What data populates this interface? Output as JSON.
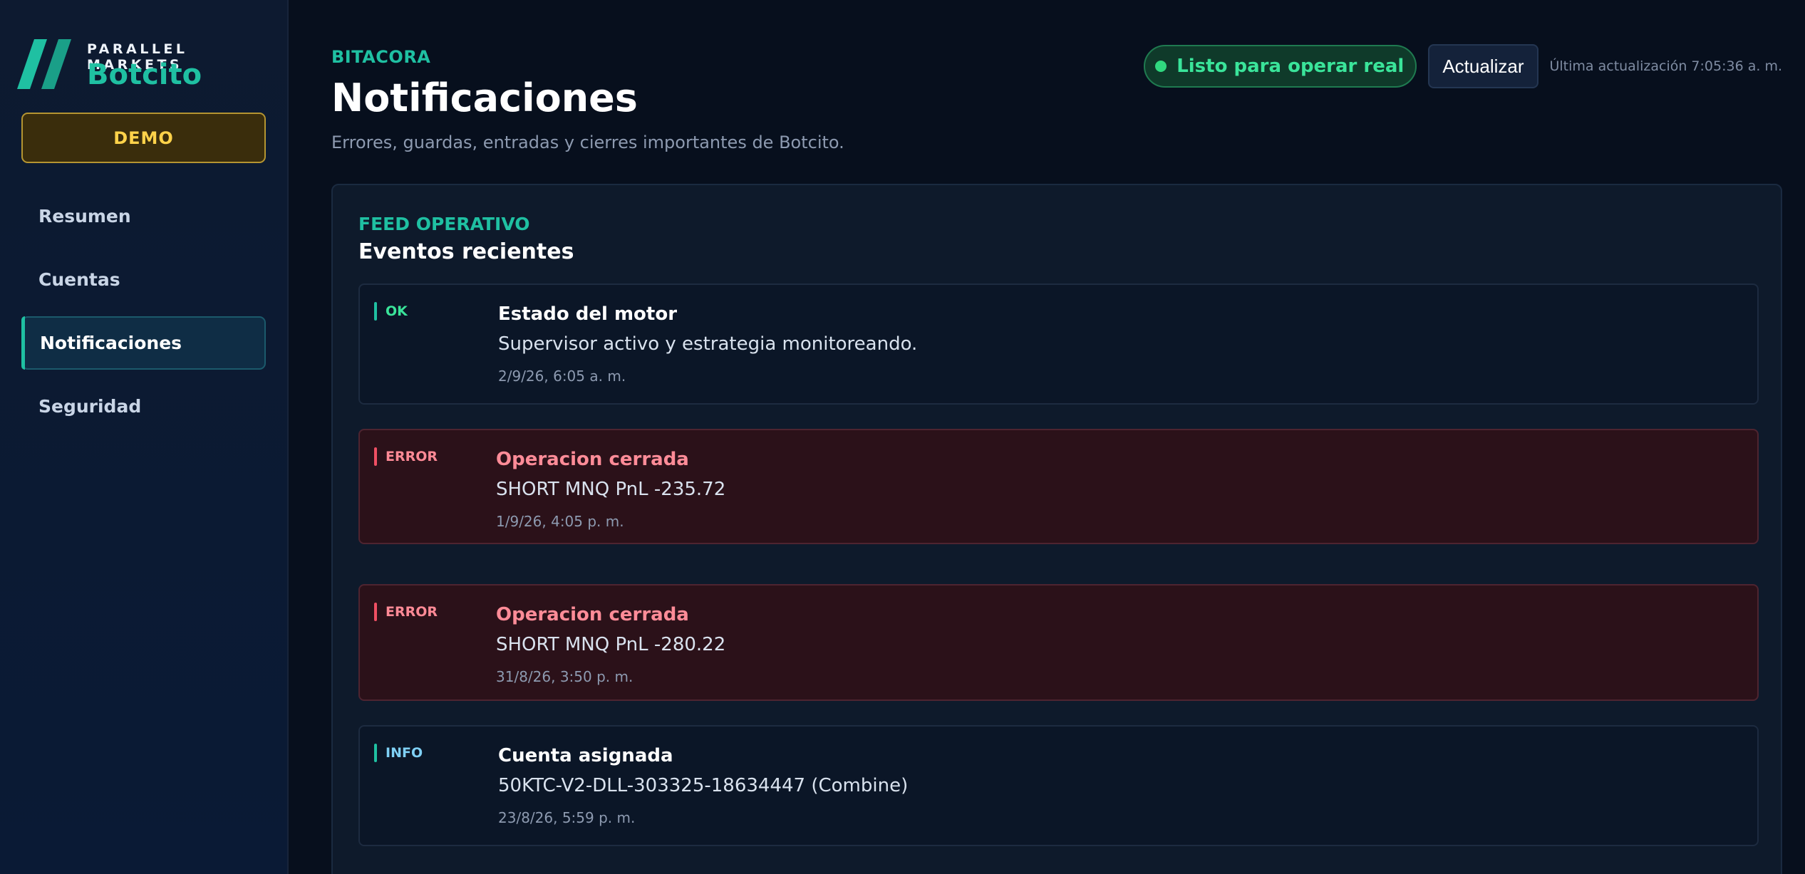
{
  "brand": {
    "company": "PARALLEL MARKETS",
    "name": "Botcito"
  },
  "mode_badge": "DEMO",
  "nav": {
    "items": [
      {
        "label": "Resumen",
        "active": false
      },
      {
        "label": "Cuentas",
        "active": false
      },
      {
        "label": "Notificaciones",
        "active": true
      },
      {
        "label": "Seguridad",
        "active": false
      }
    ]
  },
  "header": {
    "eyebrow": "BITACORA",
    "title": "Notificaciones",
    "subtitle": "Errores, guardas, entradas y cierres importantes de Botcito.",
    "status_label": "Listo para operar real",
    "refresh_label": "Actualizar",
    "last_update": "Última actualización 7:05:36 a. m."
  },
  "feed": {
    "eyebrow": "FEED OPERATIVO",
    "title": "Eventos recientes",
    "events": [
      {
        "level": "OK",
        "title": "Estado del motor",
        "message": "Supervisor activo y estrategia monitoreando.",
        "time": "2/9/26, 6:05 a. m."
      },
      {
        "level": "ERROR",
        "title": "Operacion cerrada",
        "message": "SHORT MNQ PnL -235.72",
        "time": "1/9/26, 4:05 p. m."
      },
      {
        "level": "ERROR",
        "title": "Operacion cerrada",
        "message": "SHORT MNQ PnL -280.22",
        "time": "31/8/26, 3:50 p. m."
      },
      {
        "level": "INFO",
        "title": "Cuenta asignada",
        "message": "50KTC-V2-DLL-303325-18634447 (Combine)",
        "time": "23/8/26, 5:59 p. m."
      }
    ]
  },
  "colors": {
    "accent": "#1fc0a2",
    "ok": "#3ae49a",
    "error": "#ff8a96",
    "info": "#7fd0f5",
    "demo": "#ffd24a"
  }
}
